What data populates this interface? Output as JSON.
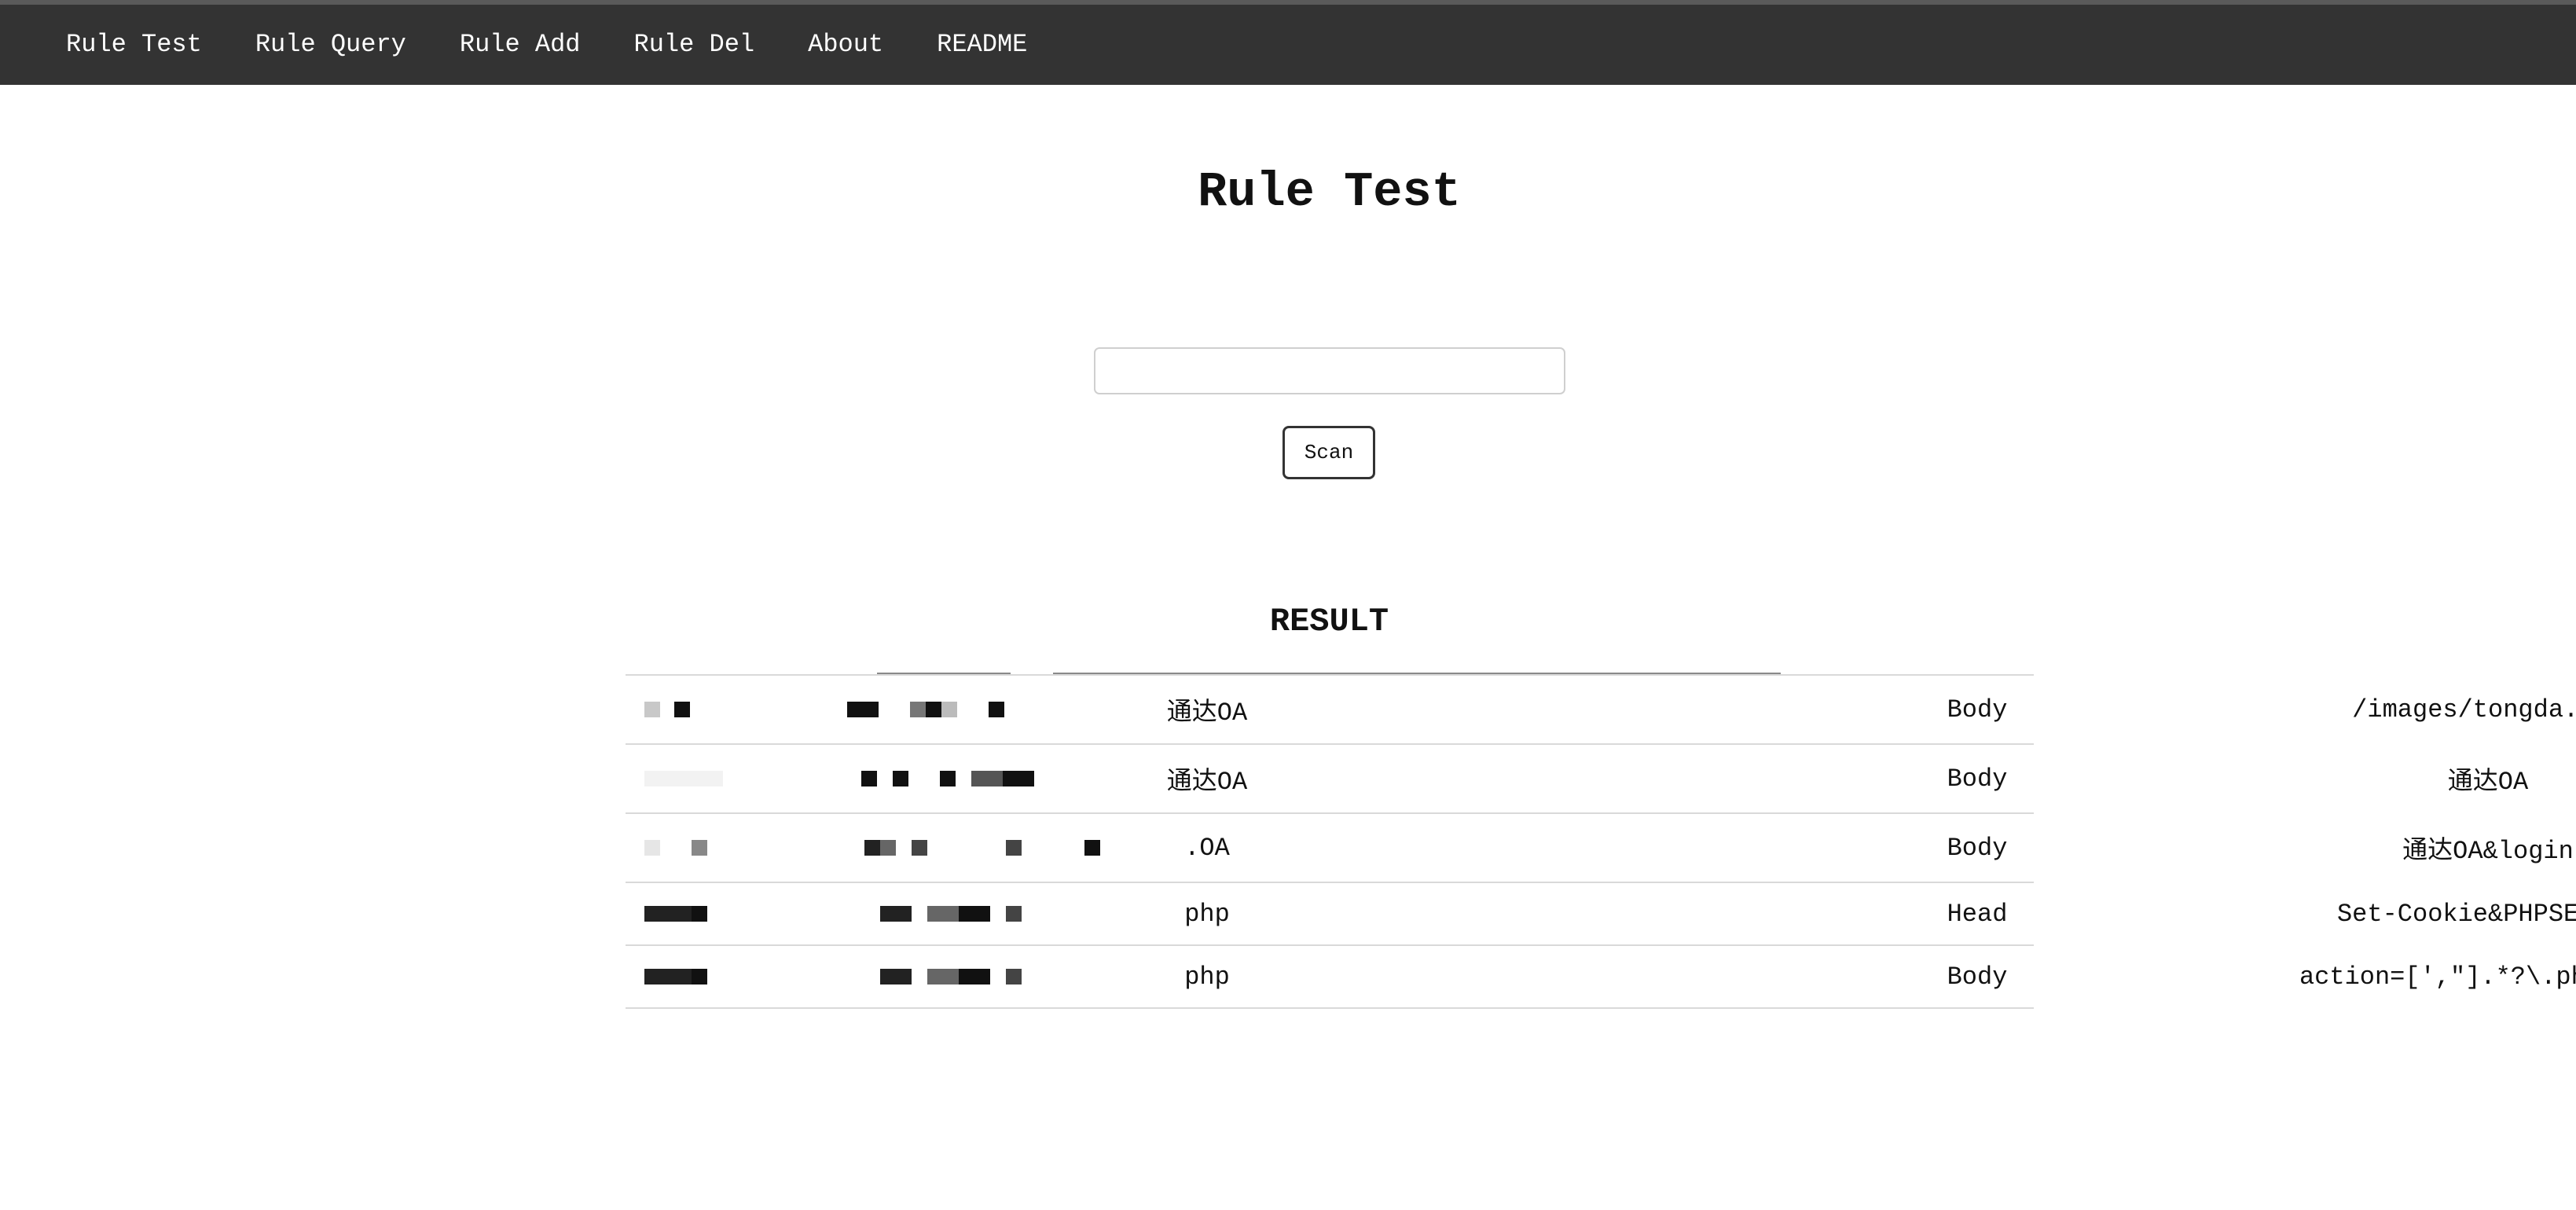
{
  "nav": {
    "items": [
      "Rule Test",
      "Rule Query",
      "Rule Add",
      "Rule Del",
      "About",
      "README"
    ]
  },
  "page": {
    "title": "Rule Test"
  },
  "search": {
    "value": "",
    "placeholder": ""
  },
  "scan_button": {
    "label": "Scan"
  },
  "result": {
    "heading": "RESULT",
    "rows": [
      {
        "name": "通达OA",
        "location": "Body",
        "rule": "/images/tongda.ico"
      },
      {
        "name": "通达OA",
        "location": "Body",
        "rule": "通达OA"
      },
      {
        "name": ".OA",
        "location": "Body",
        "rule": "通达OA&login"
      },
      {
        "name": "php",
        "location": "Head",
        "rule": "Set-Cookie&PHPSESSID"
      },
      {
        "name": "php",
        "location": "Body",
        "rule": "action=[',\"].*?\\.php['|\"]"
      }
    ]
  },
  "colors": {
    "topbar": "#333333",
    "nav_text": "#ffffff",
    "row_border": "#d9d9d9"
  }
}
